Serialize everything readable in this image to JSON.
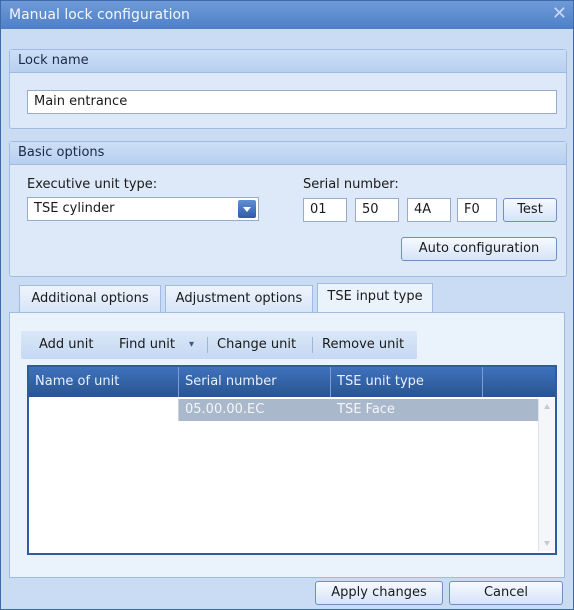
{
  "window": {
    "title": "Manual lock configuration",
    "close_glyph": "✕"
  },
  "lock_name": {
    "header": "Lock name",
    "value": "Main entrance"
  },
  "basic_options": {
    "header": "Basic options",
    "executive_unit_label": "Executive unit type:",
    "executive_unit_value": "TSE cylinder",
    "serial_label": "Serial number:",
    "serial": [
      "01",
      "50",
      "4A",
      "F0"
    ],
    "test_label": "Test",
    "auto_config_label": "Auto configuration"
  },
  "tabs": [
    {
      "label": "Additional options",
      "active": false
    },
    {
      "label": "Adjustment options",
      "active": false
    },
    {
      "label": "TSE input type",
      "active": true
    }
  ],
  "toolbar": {
    "add_unit": "Add unit",
    "find_unit": "Find unit",
    "find_unit_arrow": "▾",
    "change_unit": "Change unit",
    "remove_unit": "Remove unit"
  },
  "grid": {
    "columns": [
      "Name of unit",
      "Serial number",
      "TSE unit type"
    ],
    "rows": [
      {
        "name": "",
        "serial": "05.00.00.EC",
        "type": "TSE Face"
      }
    ]
  },
  "footer": {
    "apply_label": "Apply changes",
    "cancel_label": "Cancel"
  }
}
